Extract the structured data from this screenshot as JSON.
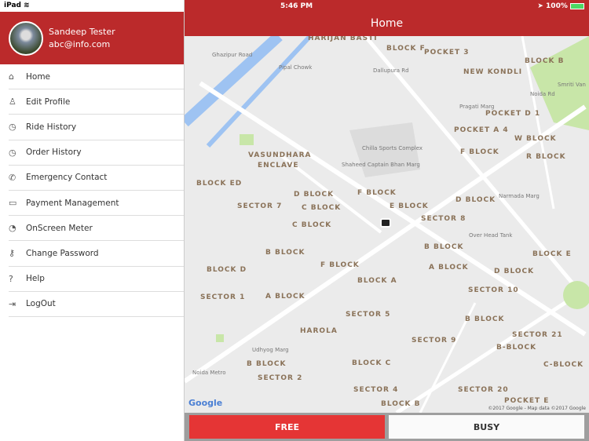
{
  "status": {
    "device": "iPad",
    "time": "5:46 PM",
    "battery": "100%"
  },
  "profile": {
    "name": "Sandeep Tester",
    "email": "abc@info.com"
  },
  "menu": [
    {
      "label": "Home",
      "icon": "home-icon"
    },
    {
      "label": "Edit Profile",
      "icon": "user-icon"
    },
    {
      "label": "Ride History",
      "icon": "clock-icon"
    },
    {
      "label": "Order History",
      "icon": "clock-icon"
    },
    {
      "label": "Emergency Contact",
      "icon": "phone-icon"
    },
    {
      "label": "Payment Management",
      "icon": "payment-icon"
    },
    {
      "label": "OnScreen Meter",
      "icon": "meter-icon"
    },
    {
      "label": "Change Password",
      "icon": "key-icon"
    },
    {
      "label": "Help",
      "icon": "help-icon"
    },
    {
      "label": "LogOut",
      "icon": "logout-icon"
    }
  ],
  "header": {
    "title": "Home"
  },
  "map": {
    "labels": [
      "HARIJAN BASTI",
      "BLOCK F",
      "POCKET 3",
      "BLOCK B",
      "NEW KONDLI",
      "POCKET D 1",
      "POCKET A 4",
      "W BLOCK",
      "F BLOCK",
      "R BLOCK",
      "VASUNDHARA",
      "ENCLAVE",
      "BLOCK ED",
      "D BLOCK",
      "F BLOCK",
      "C BLOCK",
      "E BLOCK",
      "SECTOR 7",
      "D BLOCK",
      "SECTOR 8",
      "C BLOCK",
      "B BLOCK",
      "B BLOCK",
      "F BLOCK",
      "A BLOCK",
      "BLOCK D",
      "D BLOCK",
      "BLOCK A",
      "BLOCK E",
      "SECTOR 1",
      "A BLOCK",
      "SECTOR 10",
      "SECTOR 5",
      "B BLOCK",
      "HAROLA",
      "SECTOR 21",
      "SECTOR 9",
      "B-BLOCK",
      "B BLOCK",
      "BLOCK C",
      "C-BLOCK",
      "SECTOR 2",
      "SECTOR 4",
      "SECTOR 20",
      "BLOCK B",
      "POCKET E"
    ],
    "small": [
      "Pipal Chowk",
      "Chilla Sports Complex",
      "Smriti Van",
      "Noida Rd",
      "Pragati Marg",
      "Udhyog Marg",
      "Ghazipur Road",
      "Dallupura Rd",
      "Shaheed Captain Bhan Marg",
      "Narmada Marg",
      "Noida Metro",
      "Over Head Tank"
    ],
    "google": "Google",
    "copyright": "©2017 Google - Map data ©2017 Google"
  },
  "buttons": {
    "free": "FREE",
    "busy": "BUSY"
  }
}
